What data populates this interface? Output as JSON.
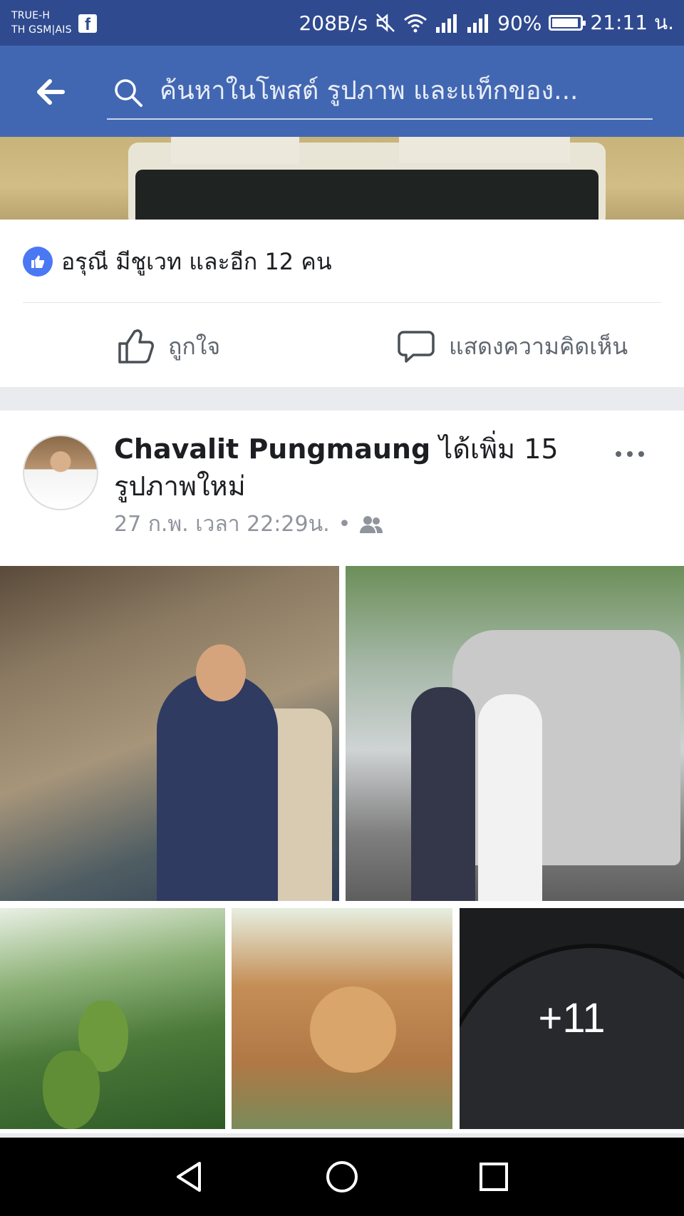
{
  "status_bar": {
    "carrier_line1": "TRUE-H",
    "carrier_line2": "TH GSM|AIS",
    "app_icon": "facebook-icon",
    "net_speed": "208B/s",
    "battery": "90%",
    "time": "21:11 น."
  },
  "search": {
    "placeholder": "ค้นหาในโพสต์ รูปภาพ และแท็กของ..."
  },
  "previous_post": {
    "reactions_text": "อรุณี มีชูเวท และอีก 12 คน",
    "like_label": "ถูกใจ",
    "comment_label": "แสดงความคิดเห็น"
  },
  "post": {
    "author": "Chavalit Pungmaung",
    "action": " ได้เพิ่ม 15 รูปภาพใหม่",
    "timestamp": "27 ก.พ. เวลา 22:29น.",
    "separator": "•",
    "audience_icon": "friends-icon",
    "more_photos": "+11"
  },
  "colors": {
    "fb_blue": "#4267b2",
    "status_blue": "#2f4a8f",
    "like_blue": "#4a78f5"
  }
}
